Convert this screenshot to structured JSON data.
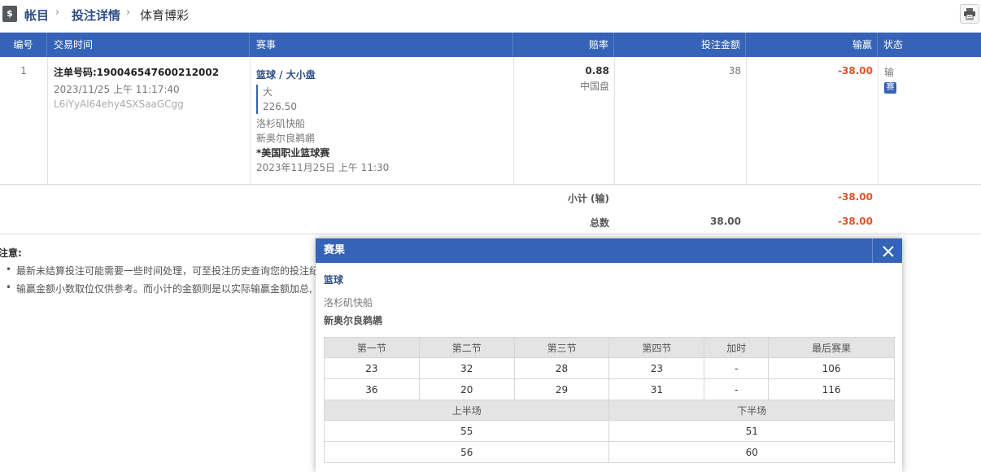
{
  "breadcrumb": {
    "icon_glyph": "$",
    "items": [
      "帐目",
      "投注详情",
      "体育博彩"
    ]
  },
  "table": {
    "columns": [
      "编号",
      "交易时间",
      "赛事",
      "赔率",
      "投注金额",
      "输赢",
      "状态"
    ],
    "row": {
      "index": "1",
      "ticket_label": "注单号码:190046547600212002",
      "datetime": "2023/11/25 上午 11:17:40",
      "code": "L6iYyAl64ehy4SXSaaGCgg",
      "market": "篮球 / 大小盘",
      "selection": "大",
      "line": "226.50",
      "team_home": "洛杉矶快船",
      "team_away": "新奥尔良鹈鹕",
      "league": "*美国职业篮球赛",
      "event_time": "2023年11月25日 上午 11:30",
      "odds": "0.88",
      "odds_type": "中国盘",
      "stake": "38",
      "result": "-38.00",
      "status": "输",
      "status_badge": "赛"
    },
    "subtotal_label": "小计 (输)",
    "subtotal_result": "-38.00",
    "total_label": "总数",
    "total_stake": "38.00",
    "total_result": "-38.00"
  },
  "notes": {
    "title": "注意:",
    "items": [
      "最新未结算投注可能需要一些时间处理，可至投注历史查询您的投注纪",
      "输赢金额小数取位仅供参考。而小计的金额则是以实际输赢金额加总,"
    ]
  },
  "modal": {
    "title": "赛果",
    "sport": "篮球",
    "team_home": "洛杉矶快船",
    "team_away": "新奥尔良鹈鹕",
    "quarter_headers": [
      "第一节",
      "第二节",
      "第三节",
      "第四节",
      "加时",
      "最后赛果"
    ],
    "quarter_rows": [
      [
        "23",
        "32",
        "28",
        "23",
        "-",
        "106"
      ],
      [
        "36",
        "20",
        "29",
        "31",
        "-",
        "116"
      ]
    ],
    "half_headers": [
      "上半场",
      "下半场"
    ],
    "half_rows": [
      [
        "55",
        "51"
      ],
      [
        "56",
        "60"
      ]
    ]
  },
  "colors": {
    "header_blue": "#3563b7",
    "loss_red": "#e0542a",
    "link_blue": "#2f4f86"
  }
}
